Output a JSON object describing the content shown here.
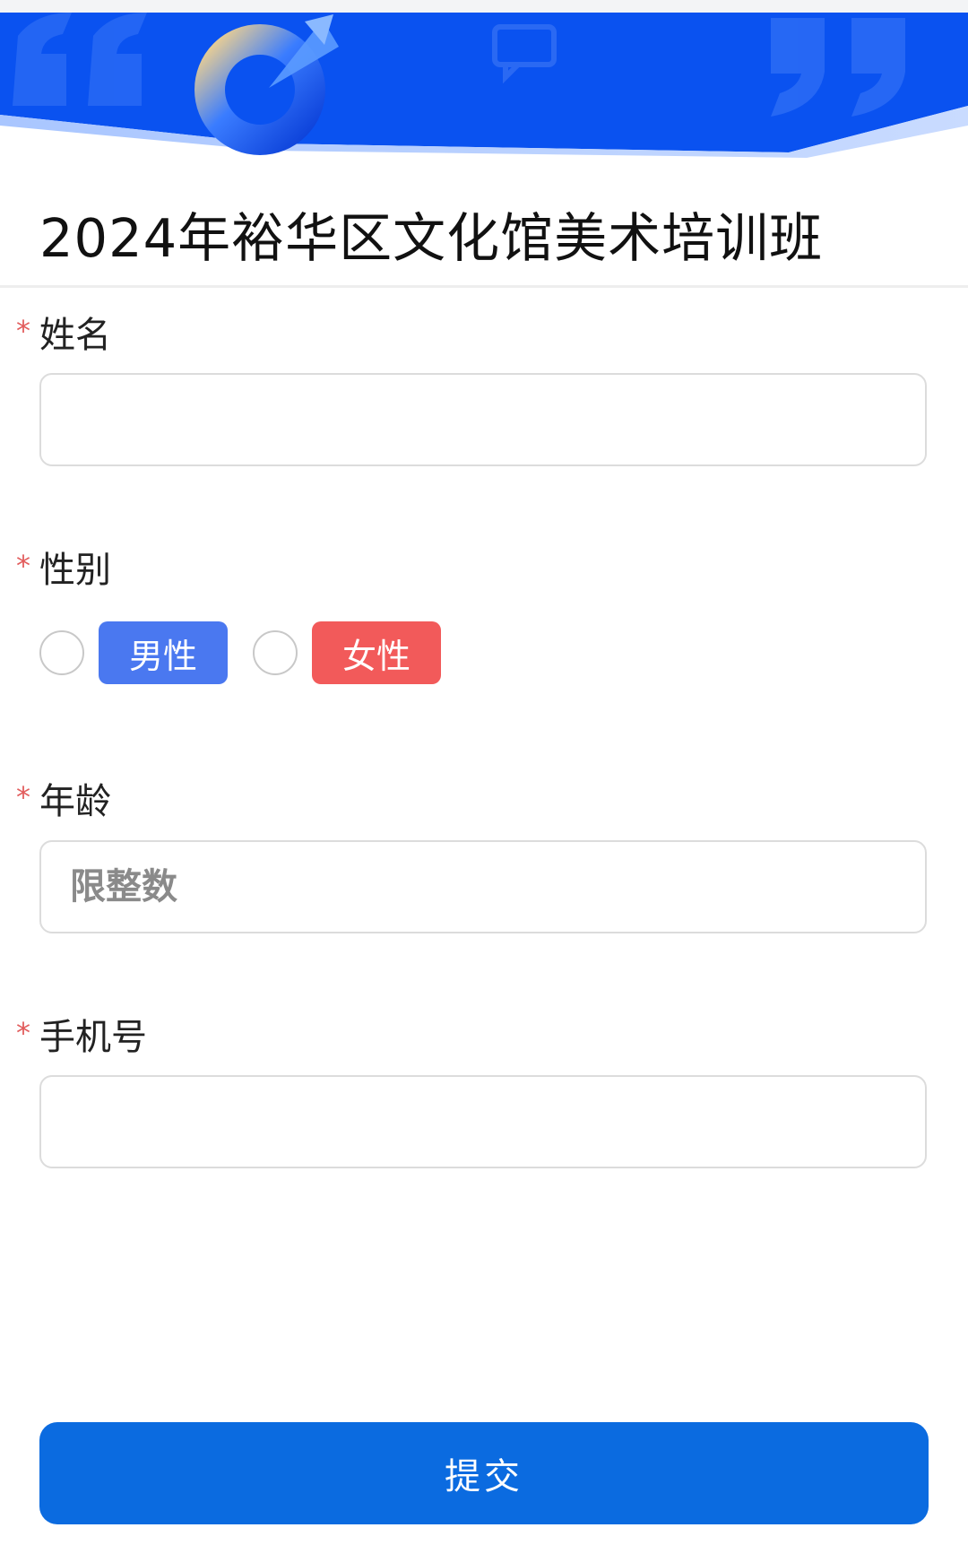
{
  "header": {
    "title": "2024年裕华区文化馆美术培训班"
  },
  "form": {
    "name": {
      "label": "姓名",
      "required_mark": "*",
      "value": "",
      "placeholder": ""
    },
    "gender": {
      "label": "性别",
      "required_mark": "*",
      "options": [
        {
          "label": "男性",
          "color": "#4a78f0",
          "checked": false
        },
        {
          "label": "女性",
          "color": "#f25a5a",
          "checked": false
        }
      ]
    },
    "age": {
      "label": "年龄",
      "required_mark": "*",
      "value": "",
      "placeholder": "限整数"
    },
    "phone": {
      "label": "手机号",
      "required_mark": "*",
      "value": "",
      "placeholder": ""
    }
  },
  "submit_label": "提交",
  "colors": {
    "banner_blue": "#0a52f0",
    "submit_blue": "#0b6be0",
    "required_red": "#e25d5d"
  }
}
